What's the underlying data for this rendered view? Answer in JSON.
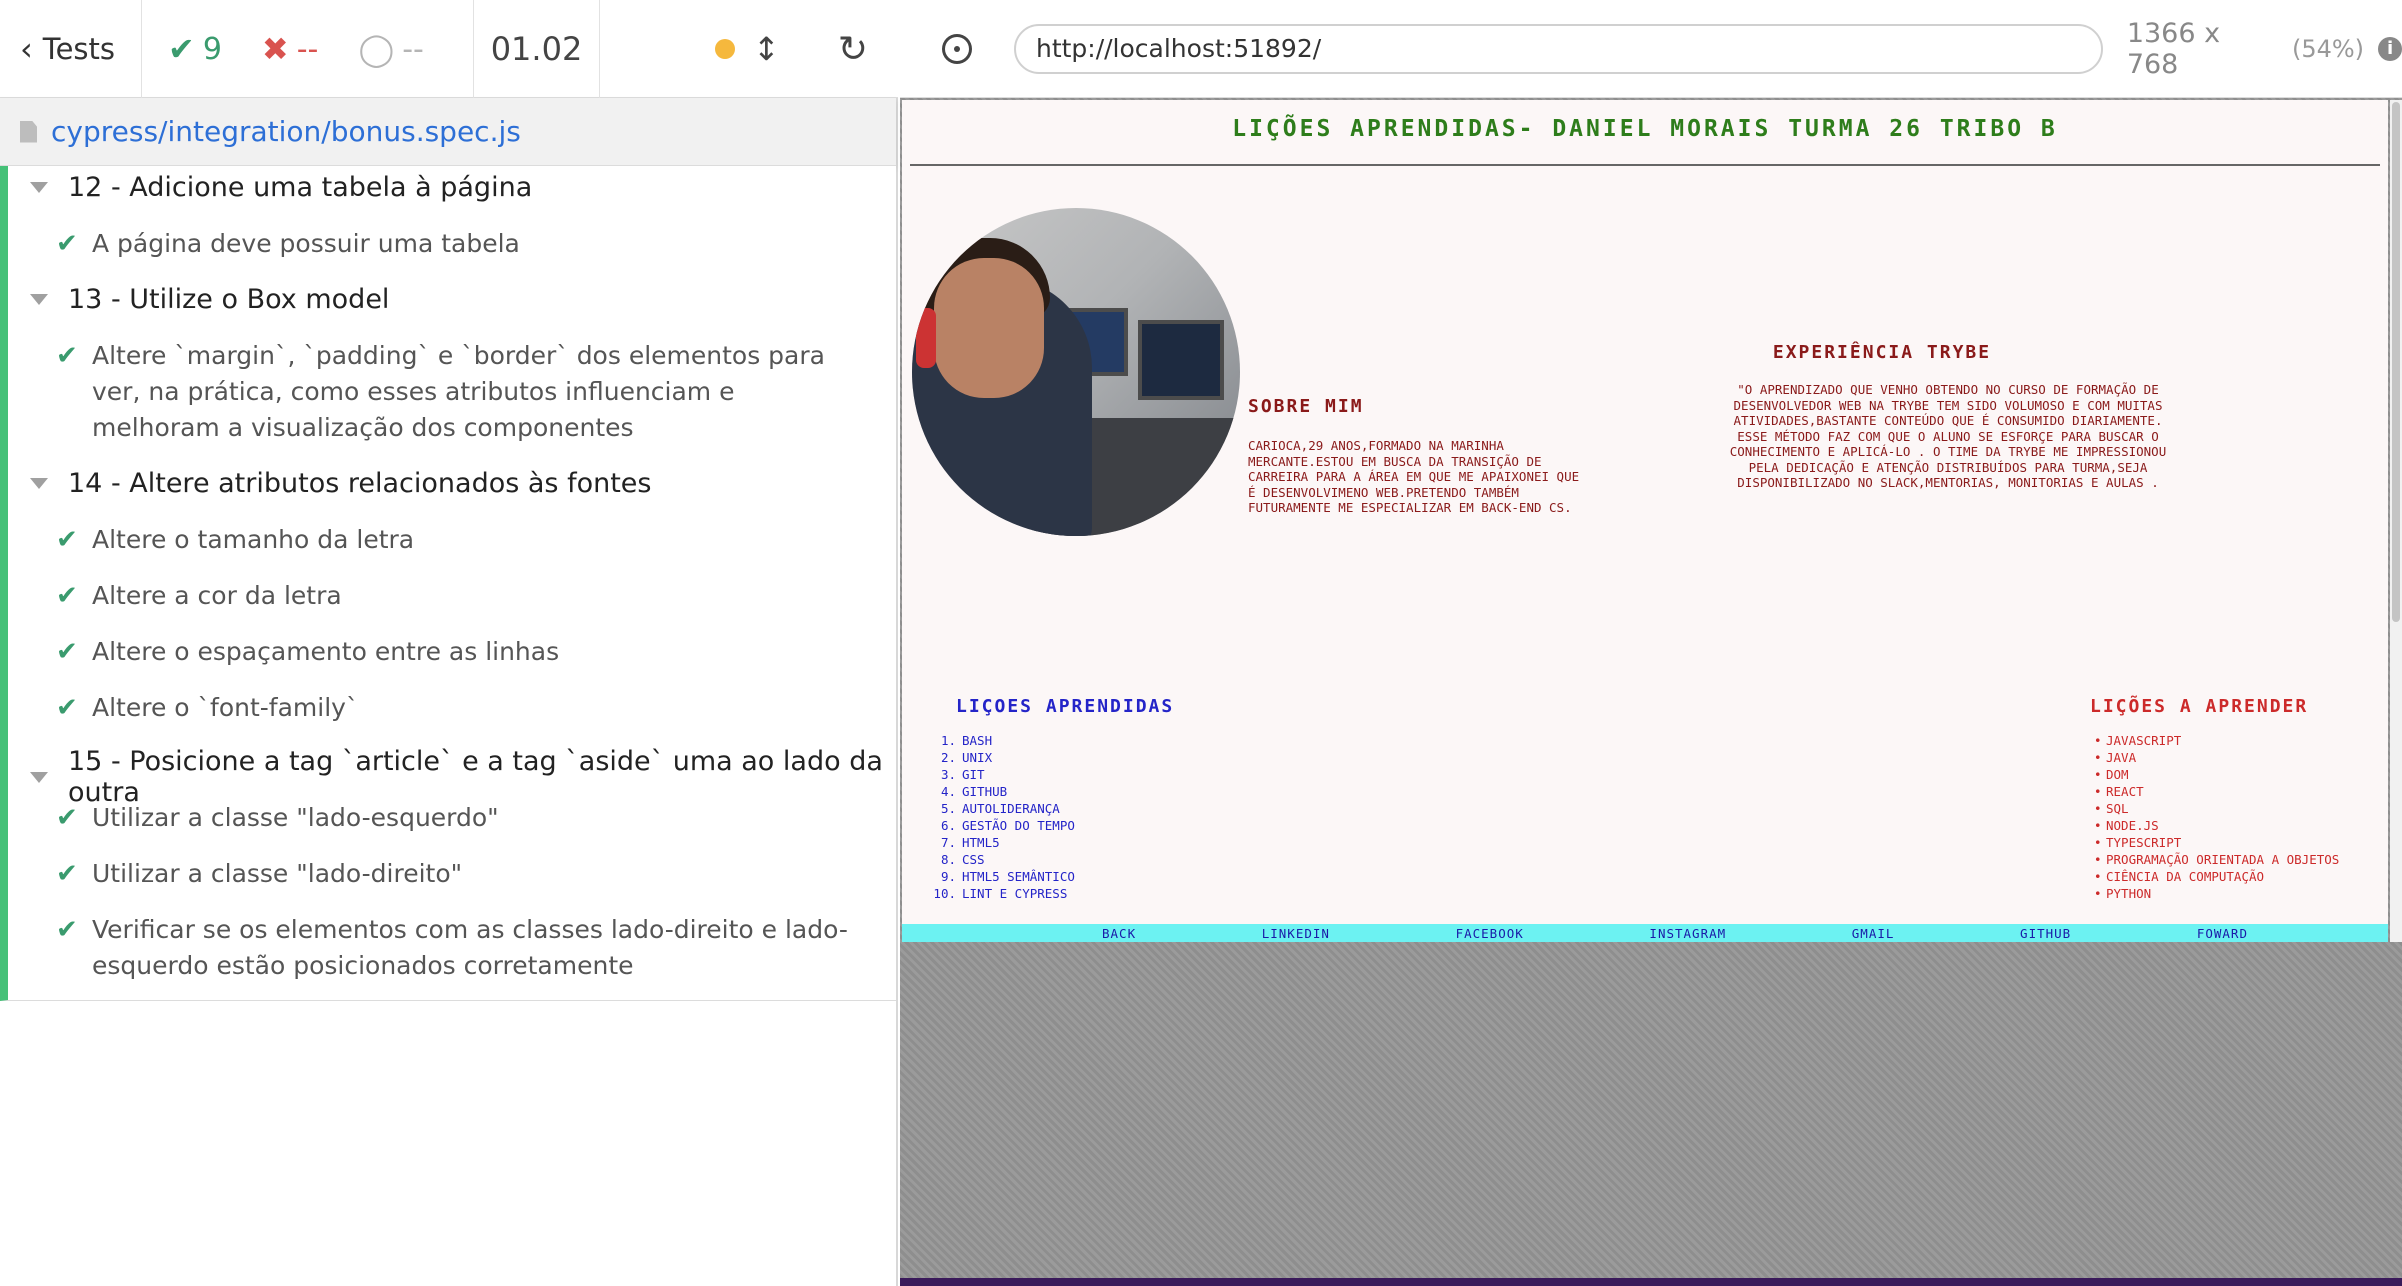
{
  "reporter": {
    "tests_label": "Tests",
    "stats": {
      "passed": "9",
      "failed": "--",
      "pending": "--"
    },
    "duration": "01.02",
    "spec_path": "cypress/integration/bonus.spec.js",
    "suites": [
      {
        "title": "12 - Adicione uma tabela à página",
        "tests": [
          "A página deve possuir uma tabela"
        ]
      },
      {
        "title": "13 - Utilize o Box model",
        "tests": [
          "Altere `margin`, `padding` e `border` dos elementos para ver, na prática, como esses atributos influenciam e melhoram a visualização dos componentes"
        ]
      },
      {
        "title": "14 - Altere atributos relacionados às fontes",
        "tests": [
          "Altere o tamanho da letra",
          "Altere a cor da letra",
          "Altere o espaçamento entre as linhas",
          "Altere o `font-family`"
        ]
      },
      {
        "title": "15 - Posicione a tag `article` e a tag `aside` uma ao lado da outra",
        "tests": [
          "Utilizar a classe \"lado-esquerdo\"",
          "Utilizar a classe \"lado-direito\"",
          "Verificar se os elementos com as classes lado-direito e lado-esquerdo estão posicionados corretamente"
        ]
      }
    ]
  },
  "aut": {
    "url": "http://localhost:51892/",
    "viewport": "1366 x 768",
    "scale": "(54%)",
    "colors": {
      "title": "#2e7d1b",
      "text": "#8a1a1a",
      "learned": "#2424c8",
      "to_learn": "#cc2a2a",
      "footer": "#6cf2f2"
    }
  },
  "site": {
    "title": "LIÇÕES APRENDIDAS- DANIEL MORAIS TURMA 26 TRIBO B",
    "about_heading": "SOBRE MIM",
    "about_text": "Carioca,29 anos,formado na Marinha Mercante.Estou em busca da transição de carreira para a área em que me apaixonei que é desenvolvimeno web.Pretendo também futuramente me especializar em Back-end CS.",
    "trybe_heading": "EXPERIÊNCIA TRYBE",
    "trybe_text": "\"O aprendizado que venho obtendo no curso de formação de desenvolvedor web na trybe tem sido volumoso e com muitas atividades,bastante conteúdo que é consumido diariamente. Esse método faz com que o aluno se esforçe para buscar o conhecimento e aplicá-lo . O time da trybe me impressionou pela dedicação e atenção distribuídos para turma,seja disponibilizado no slack,mentorias, monitorias e aulas .",
    "learned_heading": "LIÇOES APRENDIDAS",
    "learned": [
      "Bash",
      "Unix",
      "Git",
      "Github",
      "Autoliderança",
      "Gestão do tempo",
      "HTML5",
      "CSS",
      "HTML5 Semântico",
      "Lint e Cypress"
    ],
    "to_learn_heading": "LIÇÕES A APRENDER",
    "to_learn": [
      "JavaScript",
      "Java",
      "DOM",
      "React",
      "SQL",
      "Node.js",
      "Typescript",
      "Programação Orientada a Objetos",
      "Ciência da Computação",
      "Python"
    ],
    "footer_links": [
      "Back",
      "LinkedIn",
      "Facebook",
      "Instagram",
      "Gmail",
      "GitHub",
      "Foward"
    ]
  }
}
